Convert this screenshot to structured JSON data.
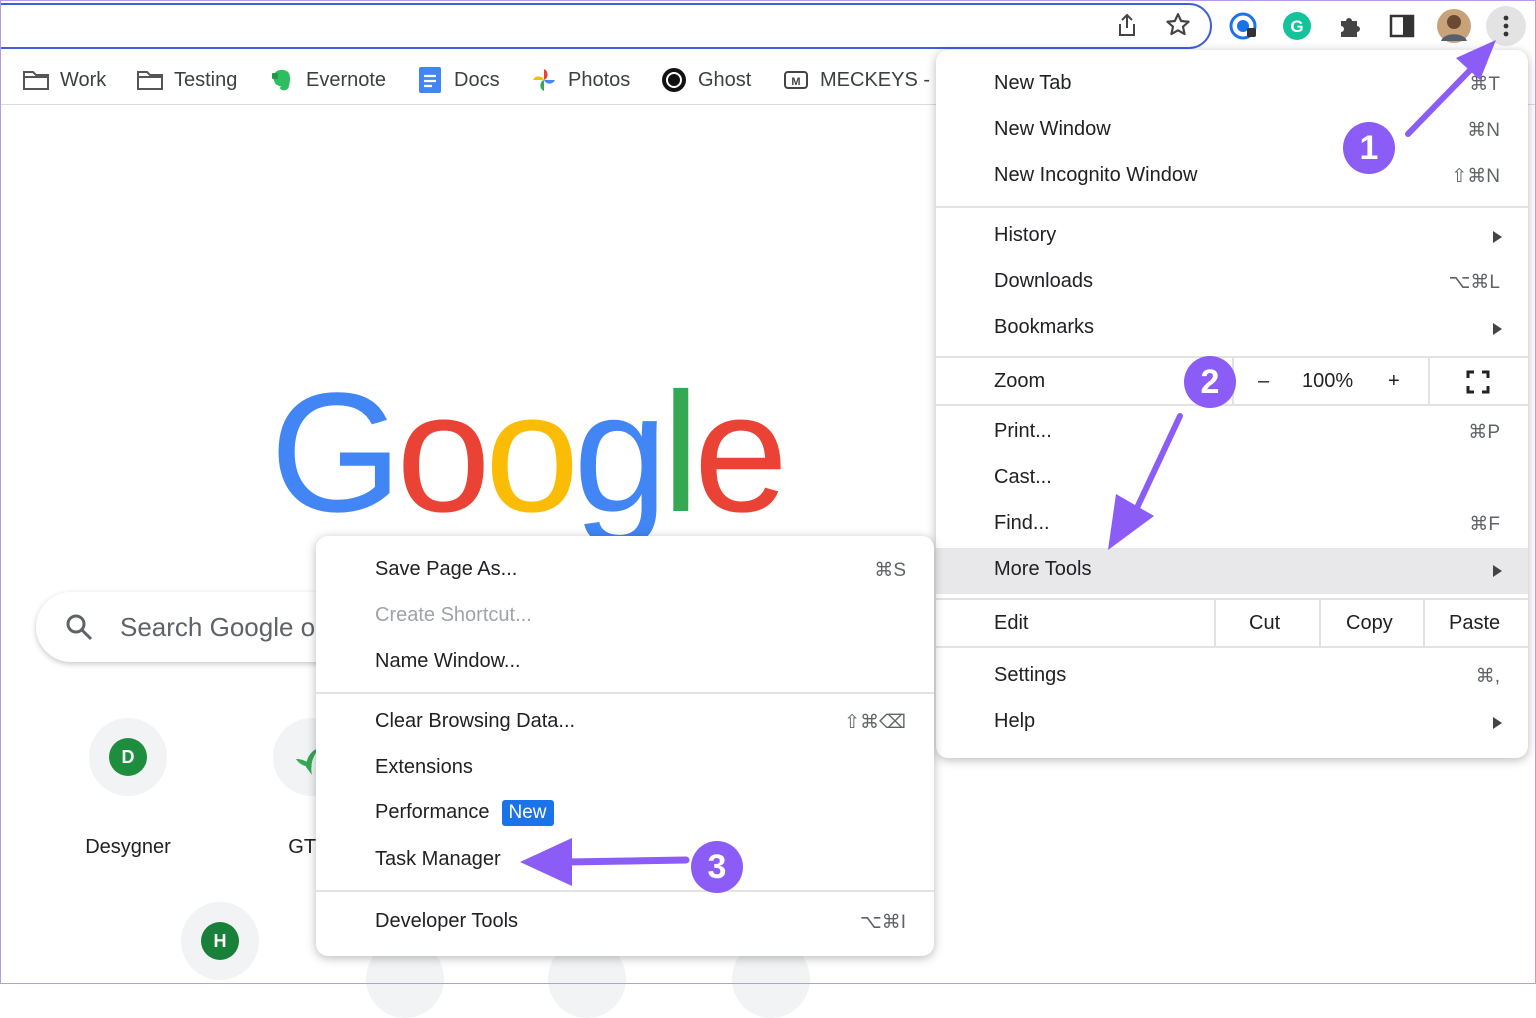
{
  "bookmarks": {
    "items": [
      {
        "label": "Work",
        "icon": "folder-icon"
      },
      {
        "label": "Testing",
        "icon": "folder-icon"
      },
      {
        "label": "Evernote",
        "icon": "evernote-icon"
      },
      {
        "label": "Docs",
        "icon": "docs-icon"
      },
      {
        "label": "Photos",
        "icon": "photos-icon"
      },
      {
        "label": "Ghost",
        "icon": "ghost-icon"
      },
      {
        "label": "MECKEYS -",
        "icon": "meckeys-icon"
      }
    ]
  },
  "logo": {
    "letters": [
      "G",
      "o",
      "o",
      "g",
      "l",
      "e"
    ],
    "colors": [
      "#4285f4",
      "#ea4335",
      "#fbbc05",
      "#4285f4",
      "#34a853",
      "#ea4335"
    ]
  },
  "search": {
    "text": "Search Google or"
  },
  "shortcuts": [
    {
      "label": "Desygner",
      "initial": "D",
      "color": "#1e8e3e"
    },
    {
      "label": "GT D",
      "initial": "",
      "color": "#34a853"
    }
  ],
  "shortcuts_row2": [
    {
      "initial": "H",
      "color": "#188038"
    }
  ],
  "chrome_menu": {
    "new_tab": {
      "label": "New Tab",
      "shortcut": "⌘T"
    },
    "new_window": {
      "label": "New Window",
      "shortcut": "⌘N"
    },
    "new_incognito": {
      "label": "New Incognito Window",
      "shortcut": "⇧⌘N"
    },
    "history": {
      "label": "History"
    },
    "downloads": {
      "label": "Downloads",
      "shortcut": "⌥⌘L"
    },
    "bookmarks": {
      "label": "Bookmarks"
    },
    "zoom": {
      "label": "Zoom",
      "minus": "–",
      "value": "100%",
      "plus": "+"
    },
    "print": {
      "label": "Print...",
      "shortcut": "⌘P"
    },
    "cast": {
      "label": "Cast..."
    },
    "find": {
      "label": "Find...",
      "shortcut": "⌘F"
    },
    "more_tools": {
      "label": "More Tools"
    },
    "edit": {
      "label": "Edit",
      "cut": "Cut",
      "copy": "Copy",
      "paste": "Paste"
    },
    "settings": {
      "label": "Settings",
      "shortcut": "⌘,"
    },
    "help": {
      "label": "Help"
    }
  },
  "more_tools_menu": {
    "save_page": {
      "label": "Save Page As...",
      "shortcut": "⌘S"
    },
    "create_shortcut": {
      "label": "Create Shortcut..."
    },
    "name_window": {
      "label": "Name Window..."
    },
    "clear_browsing": {
      "label": "Clear Browsing Data...",
      "shortcut": "⇧⌘⌫"
    },
    "extensions": {
      "label": "Extensions"
    },
    "performance": {
      "label": "Performance",
      "badge": "New"
    },
    "task_manager": {
      "label": "Task Manager"
    },
    "developer_tools": {
      "label": "Developer Tools",
      "shortcut": "⌥⌘I"
    }
  },
  "callouts": [
    "1",
    "2",
    "3"
  ],
  "colors": {
    "callout": "#8b5cf6",
    "highlight": "#e8e8ea",
    "accent": "#1a73e8"
  }
}
